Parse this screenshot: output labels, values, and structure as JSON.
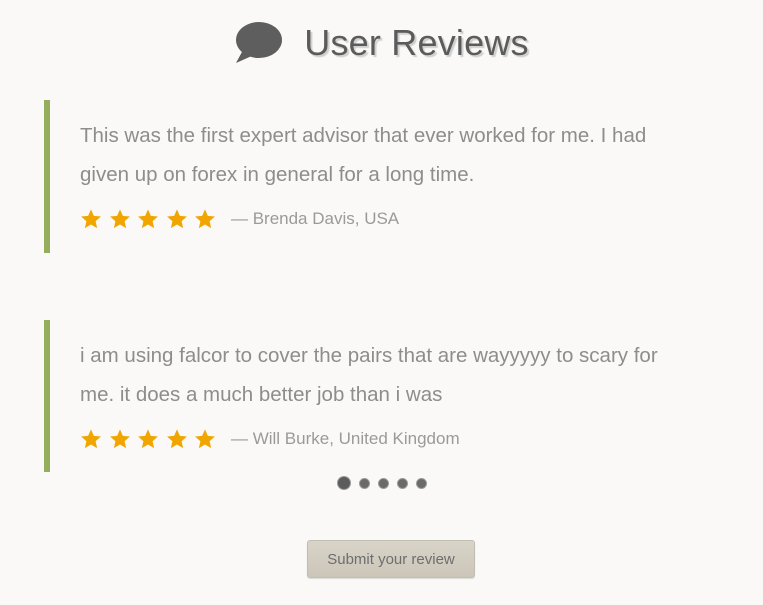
{
  "header": {
    "title": "User Reviews",
    "icon": "speech-bubble-icon"
  },
  "reviews": [
    {
      "text": "This was the first expert advisor that ever worked for me. I had given up on forex in general for a long time.",
      "rating": 5,
      "author": "— Brenda Davis, USA"
    },
    {
      "text": "i am using falcor to cover the pairs that are wayyyyy to scary for me. it does a much better job than i was",
      "rating": 5,
      "author": "— Will Burke, United Kingdom"
    }
  ],
  "pagination": {
    "count": 5,
    "active_index": 0
  },
  "submit_button": {
    "label": "Submit your review"
  },
  "colors": {
    "accent_border": "#94ae5e",
    "star": "#f0a500",
    "background": "#faf9f7",
    "button": "#d3cec2"
  }
}
